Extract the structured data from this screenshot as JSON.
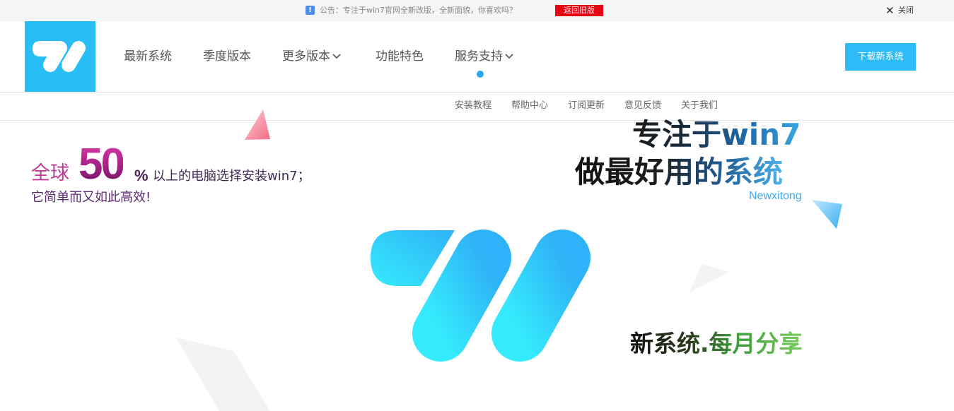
{
  "notice": {
    "icon": "info-exclamation-icon",
    "text": "公告：专注于win7官网全新改版，全新面貌，你喜欢吗？",
    "return_label": "返回旧版",
    "close_label": "关闭"
  },
  "header": {
    "logo": "brand-logo",
    "nav": [
      {
        "label": "最新系统",
        "dropdown": false
      },
      {
        "label": "季度版本",
        "dropdown": false
      },
      {
        "label": "更多版本",
        "dropdown": true
      },
      {
        "label": "功能特色",
        "dropdown": false
      },
      {
        "label": "服务支持",
        "dropdown": true
      }
    ],
    "download_label": "下载新系统"
  },
  "subnav": [
    "安装教程",
    "帮助中心",
    "订阅更新",
    "意见反馈",
    "关于我们"
  ],
  "hero": {
    "prefix": "全球",
    "percent_value": "50",
    "percent_sign": "%",
    "line1_rest": "以上的电脑选择安装win7；",
    "line2": "它简单而又如此高效!",
    "slogan_line1": "专注于win7",
    "slogan_line2": "做最好用的系统",
    "slogan_en": "Newxitong",
    "slogan_line3": "新系统.每月分享"
  },
  "colors": {
    "brand_blue": "#29bdf6",
    "return_red": "#e60012",
    "download_blue": "#2ebbf7",
    "accent_magenta": "#b83d93"
  }
}
